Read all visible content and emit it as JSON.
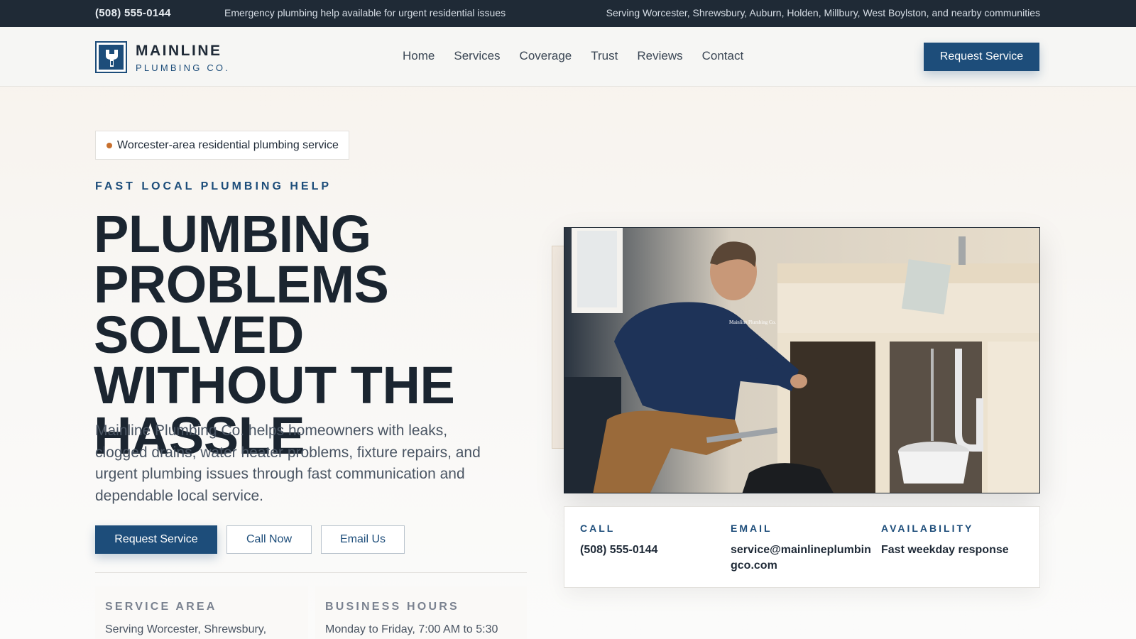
{
  "topbar": {
    "phone": "(508) 555-0144",
    "emergency": "Emergency plumbing help available for urgent residential issues",
    "serving": "Serving Worcester, Shrewsbury, Auburn, Holden, Millbury, West Boylston, and nearby communities"
  },
  "header": {
    "brand_main": "MAINLINE",
    "brand_sub": "PLUMBING CO.",
    "nav": [
      "Home",
      "Services",
      "Coverage",
      "Trust",
      "Reviews",
      "Contact"
    ],
    "cta": "Request Service"
  },
  "hero": {
    "badge": "Worcester-area residential plumbing service",
    "eyebrow": "FAST LOCAL PLUMBING HELP",
    "headline": "PLUMBING PROBLEMS SOLVED WITHOUT THE HASSLE",
    "lead": "Mainline Plumbing Co. helps homeowners with leaks, clogged drains, water heater problems, fixture repairs, and urgent plumbing issues through fast communication and dependable local service.",
    "buttons": {
      "primary": "Request Service",
      "call": "Call Now",
      "email": "Email Us"
    },
    "info": {
      "service_area_label": "SERVICE AREA",
      "service_area_value": "Serving Worcester, Shrewsbury,",
      "hours_label": "BUSINESS HOURS",
      "hours_value": "Monday to Friday, 7:00 AM to 5:30"
    }
  },
  "contact": {
    "call_label": "CALL",
    "call_value": "(508) 555-0144",
    "email_label": "EMAIL",
    "email_value": "service@mainlineplumbingco.com",
    "availability_label": "AVAILABILITY",
    "availability_value": "Fast weekday response"
  },
  "photo": {
    "shirt_text": "Mainline Plumbing Co."
  },
  "colors": {
    "brand_blue": "#1d4d7a",
    "topbar_bg": "#1f2a36",
    "accent_orange": "#c8702e"
  }
}
